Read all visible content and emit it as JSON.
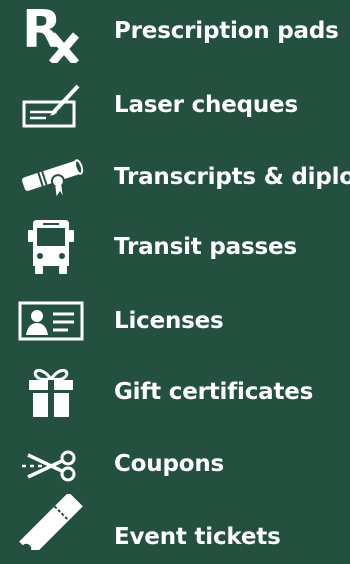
{
  "items": [
    {
      "label": "Prescription pads",
      "icon": "rx-icon"
    },
    {
      "label": "Laser cheques",
      "icon": "cheque-icon"
    },
    {
      "label": "Transcripts & diplo",
      "icon": "diploma-icon"
    },
    {
      "label": "Transit passes",
      "icon": "bus-icon"
    },
    {
      "label": "Licenses",
      "icon": "id-card-icon"
    },
    {
      "label": "Gift certificates",
      "icon": "gift-icon"
    },
    {
      "label": "Coupons",
      "icon": "scissors-icon"
    },
    {
      "label": "Event tickets",
      "icon": "ticket-icon"
    }
  ],
  "colors": {
    "background": "#24513f",
    "foreground": "#ffffff"
  }
}
